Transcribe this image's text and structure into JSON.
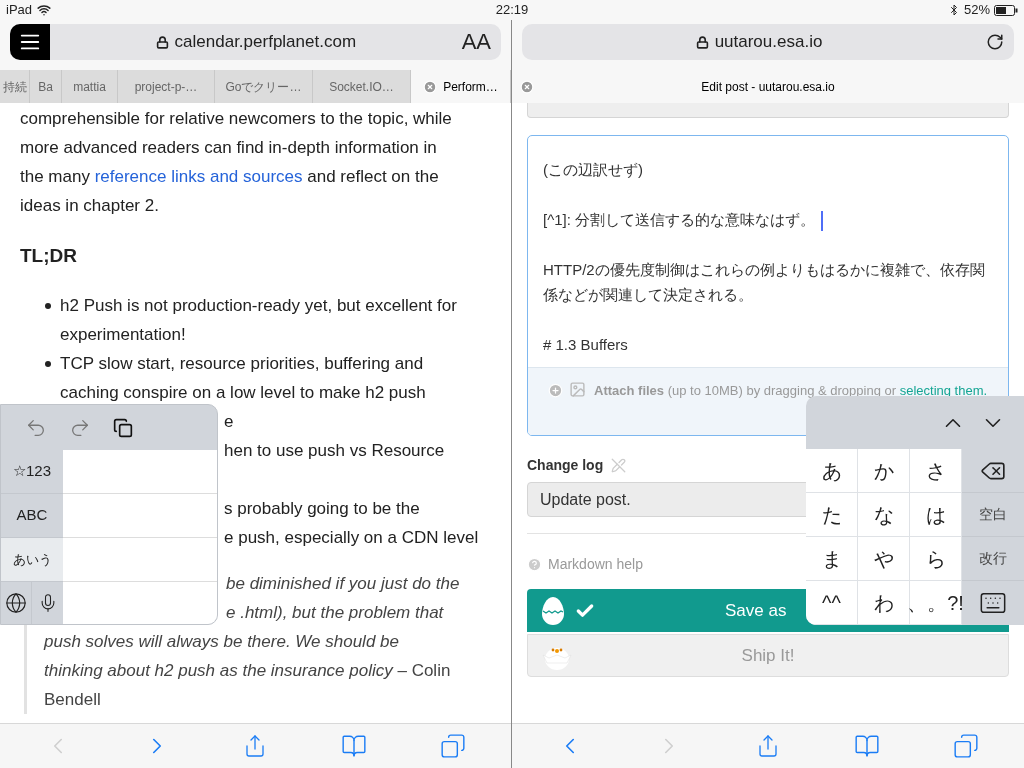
{
  "status_bar": {
    "device": "iPad",
    "time": "22:19",
    "battery": "52%"
  },
  "left_pane": {
    "address": "calendar.perfplanet.com",
    "text_size_button": "AA",
    "tabs": [
      {
        "label": "持続",
        "selected": false
      },
      {
        "label": "Ba",
        "selected": false
      },
      {
        "label": "mattia",
        "selected": false
      },
      {
        "label": "project-p-…",
        "selected": false
      },
      {
        "label": "Goでクリー…",
        "selected": false
      },
      {
        "label": "Socket.IO…",
        "selected": false
      },
      {
        "label": "Perform…",
        "selected": true
      }
    ],
    "article": {
      "intro": [
        {
          "text": "comprehensible for relative newcomers to the topic, while"
        },
        {
          "text": "more advanced readers can find in-depth information in"
        },
        {
          "before": "the many ",
          "link": "reference links and sources",
          "after": " and reflect on the"
        },
        {
          "text": "ideas in chapter 2."
        }
      ],
      "heading": "TL;DR",
      "bullets": [
        {
          "marker_visible": true,
          "lines": [
            {
              "text": "h2 Push is not production-ready yet, but excellent for",
              "covered": false
            },
            {
              "text": "experimentation!",
              "covered": false
            }
          ]
        },
        {
          "marker_visible": true,
          "lines": [
            {
              "text": "TCP slow start, resource priorities, buffering and",
              "covered": false
            },
            {
              "text": "caching conspire on a low level to make h2 push",
              "covered": false
            },
            {
              "text": "e",
              "covered": true
            }
          ]
        },
        {
          "marker_visible": false,
          "lines": [
            {
              "text": "hen to use push vs Resource",
              "covered": true
            }
          ]
        },
        {
          "marker_visible": false,
          "lines": [
            {
              "text": "s probably going to be the",
              "covered": true
            },
            {
              "text": "e push, especially on a CDN level",
              "covered": true
            }
          ]
        }
      ],
      "quote": [
        {
          "text": "be diminished if you just do the",
          "italic": true,
          "covered": true
        },
        {
          "text": "e .html), but the problem that",
          "italic": true,
          "covered": true
        },
        {
          "text": "push solves will always be there. We should be",
          "italic": true,
          "covered": false
        },
        {
          "text": "*thinking about h2 push as the insurance policy* – Colin",
          "italic": false,
          "covered": false
        },
        {
          "text": "Bendell",
          "italic": false,
          "covered": false
        }
      ]
    },
    "toolbar": {
      "back_enabled": false,
      "forward_enabled": true
    }
  },
  "right_pane": {
    "address": "uutarou.esa.io",
    "tabs": [
      {
        "label": "Edit post - uutarou.esa.io",
        "selected": true
      }
    ],
    "editor": {
      "lines": [
        {
          "text": "(この辺訳せず)",
          "caret": false
        },
        {
          "text": "[^1]: 分割して送信する的な意味なはず。",
          "caret": true
        },
        {
          "text": "HTTP/2の優先度制御はこれらの例よりもはるかに複雑で、依存関係などが関連して決定される。",
          "caret": false
        },
        {
          "text": "# 1.3 Buffers",
          "caret": false
        }
      ],
      "attach_label": "Attach files",
      "attach_note": "(up to 10MB) by dragging & dropping or ",
      "attach_link": "selecting them."
    },
    "change_log": {
      "label": "Change log",
      "value": "Update post."
    },
    "markdown_help": "Markdown help",
    "save_button": "Save as",
    "ship_button": "Ship It!",
    "toolbar": {
      "back_enabled": true,
      "forward_enabled": false
    }
  },
  "left_keyboard": {
    "modes": [
      {
        "label": "☆123",
        "selected": false
      },
      {
        "label": "ABC",
        "selected": false
      },
      {
        "label": "あいう",
        "selected": true
      }
    ]
  },
  "right_keyboard": {
    "keys": [
      {
        "kind": "kana",
        "label": "あ"
      },
      {
        "kind": "kana",
        "label": "か"
      },
      {
        "kind": "kana",
        "label": "さ"
      },
      {
        "kind": "delete"
      },
      {
        "kind": "kana",
        "label": "た"
      },
      {
        "kind": "kana",
        "label": "な"
      },
      {
        "kind": "kana",
        "label": "は"
      },
      {
        "kind": "action",
        "label": "空白"
      },
      {
        "kind": "kana",
        "label": "ま"
      },
      {
        "kind": "kana",
        "label": "や"
      },
      {
        "kind": "kana",
        "label": "ら"
      },
      {
        "kind": "action",
        "label": "改行"
      },
      {
        "kind": "kana",
        "label": "^^"
      },
      {
        "kind": "kana",
        "label": "わ"
      },
      {
        "kind": "kana",
        "label": "、。?!"
      },
      {
        "kind": "dismiss"
      }
    ]
  }
}
